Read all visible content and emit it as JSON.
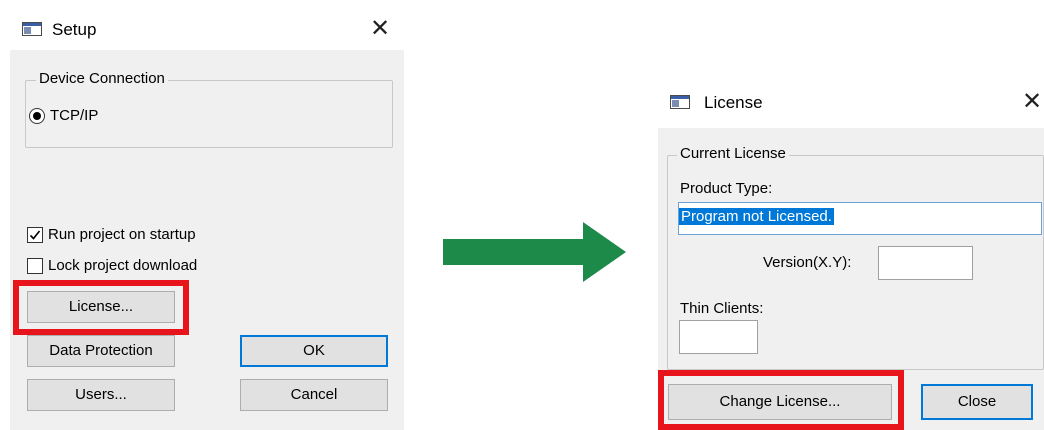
{
  "setup_dialog": {
    "title": "Setup",
    "close_glyph": "✕",
    "device_connection": {
      "legend": "Device Connection",
      "option_label": "TCP/IP",
      "option_selected": true
    },
    "run_on_startup": {
      "label": "Run project on startup",
      "checked": true
    },
    "lock_download": {
      "label": "Lock project download",
      "checked": false
    },
    "buttons": {
      "license": "License...",
      "data_protection": "Data Protection",
      "ok": "OK",
      "users": "Users...",
      "cancel": "Cancel"
    }
  },
  "arrow": {
    "color": "#1e8a4a"
  },
  "license_dialog": {
    "title": "License",
    "close_glyph": "✕",
    "current_license": {
      "legend": "Current License",
      "product_type_label": "Product Type:",
      "product_type_value": "Program not Licensed.",
      "version_label": "Version(X.Y):",
      "version_value": "",
      "thin_clients_label": "Thin Clients:",
      "thin_clients_value": ""
    },
    "buttons": {
      "change_license": "Change License...",
      "close": "Close"
    }
  },
  "colors": {
    "highlight": "#e8141c",
    "default_button_border": "#0078d7",
    "dialog_bg": "#f0f0f0",
    "selection": "#0078d7"
  }
}
